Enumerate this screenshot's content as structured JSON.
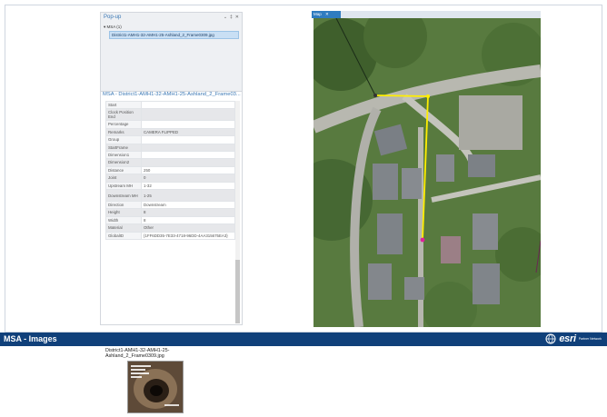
{
  "popup": {
    "title": "Pop-up",
    "controls": [
      "⌄",
      "‡",
      "✕"
    ],
    "layer": "MSA (1)",
    "selected_item": "District1-AMH1-32-AMH1-25-Ashland_2_Frame0309.jpg"
  },
  "selection": {
    "title": "MSA - District1-AMH1-32-AMH1-25-Ashland_2_Frame03...",
    "rows": [
      {
        "k": "Start",
        "v": ""
      },
      {
        "k": "Clock Position End",
        "v": ""
      },
      {
        "k": "Percentage",
        "v": ""
      },
      {
        "k": "Remarks",
        "v": "CAMERA FLIPPED"
      },
      {
        "k": "Group",
        "v": ""
      },
      {
        "k": "StartFrame",
        "v": ""
      },
      {
        "k": "Dimension1",
        "v": ""
      },
      {
        "k": "Dimension2",
        "v": ""
      },
      {
        "k": "Distance",
        "v": "250"
      },
      {
        "k": "Joint",
        "v": "0"
      },
      {
        "k": "Upstream MH",
        "v": "1-32"
      },
      {
        "k": "Downstream MH",
        "v": "1-25"
      },
      {
        "k": "Direction",
        "v": "Downstream"
      },
      {
        "k": "Height",
        "v": "8"
      },
      {
        "k": "Width",
        "v": "8"
      },
      {
        "k": "Material",
        "v": "Other"
      },
      {
        "k": "GlobalID",
        "v": "{1FF6DD35-7E33-4718-96DD-4AA315675EA3}"
      }
    ],
    "image_caption": "District1-AMH1-32-AMH1-25-Ashland_2_Frame0309.jpg"
  },
  "map": {
    "tab_label": "Map",
    "tab_close": "✕"
  },
  "footer": {
    "title": "MSA - Images",
    "logo": "esri",
    "logo_sub": "Partner Network"
  },
  "colors": {
    "footer_bg": "#10407a",
    "accent": "#3b78b5",
    "line_highlight": "#ffee00",
    "vertex": "#e0209a"
  }
}
